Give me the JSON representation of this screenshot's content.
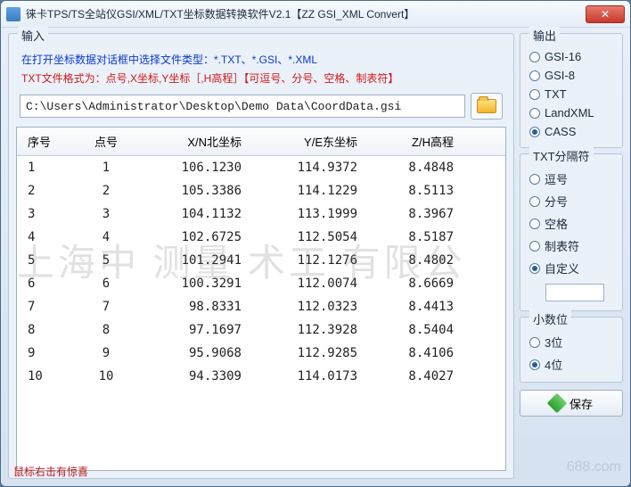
{
  "window": {
    "title": "徕卡TPS/TS全站仪GSI/XML/TXT坐标数据转换软件V2.1【ZZ GSI_XML Convert】",
    "close_symbol": "✕"
  },
  "input": {
    "legend": "输入",
    "hint_types": "在打开坐标数据对话框中选择文件类型：*.TXT、*.GSI、*.XML",
    "hint_txt": "TXT文件格式为：点号,X坐标,Y坐标［,H高程］【可逗号、分号、空格、制表符】",
    "path": "C:\\Users\\Administrator\\Desktop\\Demo Data\\CoordData.gsi"
  },
  "table": {
    "headers": {
      "seq": "序号",
      "pt": "点号",
      "xn": "X/N北坐标",
      "ye": "Y/E东坐标",
      "zh": "Z/H高程"
    },
    "rows": [
      {
        "seq": "1",
        "pt": "1",
        "xn": "106.1230",
        "ye": "114.9372",
        "zh": "8.4848"
      },
      {
        "seq": "2",
        "pt": "2",
        "xn": "105.3386",
        "ye": "114.1229",
        "zh": "8.5113"
      },
      {
        "seq": "3",
        "pt": "3",
        "xn": "104.1132",
        "ye": "113.1999",
        "zh": "8.3967"
      },
      {
        "seq": "4",
        "pt": "4",
        "xn": "102.6725",
        "ye": "112.5054",
        "zh": "8.5187"
      },
      {
        "seq": "5",
        "pt": "5",
        "xn": "101.2941",
        "ye": "112.1276",
        "zh": "8.4802"
      },
      {
        "seq": "6",
        "pt": "6",
        "xn": "100.3291",
        "ye": "112.0074",
        "zh": "8.6669"
      },
      {
        "seq": "7",
        "pt": "7",
        "xn": "98.8331",
        "ye": "112.0323",
        "zh": "8.4413"
      },
      {
        "seq": "8",
        "pt": "8",
        "xn": "97.1697",
        "ye": "112.3928",
        "zh": "8.5404"
      },
      {
        "seq": "9",
        "pt": "9",
        "xn": "95.9068",
        "ye": "112.9285",
        "zh": "8.4106"
      },
      {
        "seq": "10",
        "pt": "10",
        "xn": "94.3309",
        "ye": "114.0173",
        "zh": "8.4027"
      }
    ]
  },
  "output": {
    "legend": "输出",
    "options": [
      {
        "label": "GSI-16",
        "selected": false
      },
      {
        "label": "GSI-8",
        "selected": false
      },
      {
        "label": "TXT",
        "selected": false
      },
      {
        "label": "LandXML",
        "selected": false
      },
      {
        "label": "CASS",
        "selected": true
      }
    ]
  },
  "delimiter": {
    "legend": "TXT分隔符",
    "options": [
      {
        "label": "逗号",
        "selected": false
      },
      {
        "label": "分号",
        "selected": false
      },
      {
        "label": "空格",
        "selected": false
      },
      {
        "label": "制表符",
        "selected": false
      },
      {
        "label": "自定义",
        "selected": true
      }
    ],
    "custom_value": ""
  },
  "decimals": {
    "legend": "小数位",
    "options": [
      {
        "label": "3位",
        "selected": false
      },
      {
        "label": "4位",
        "selected": true
      }
    ]
  },
  "save_label": "保存",
  "footer_note": "鼠标右击有惊喜",
  "watermark_main": "上海中  测量  术工  有限公",
  "watermark_corner": "688.com"
}
